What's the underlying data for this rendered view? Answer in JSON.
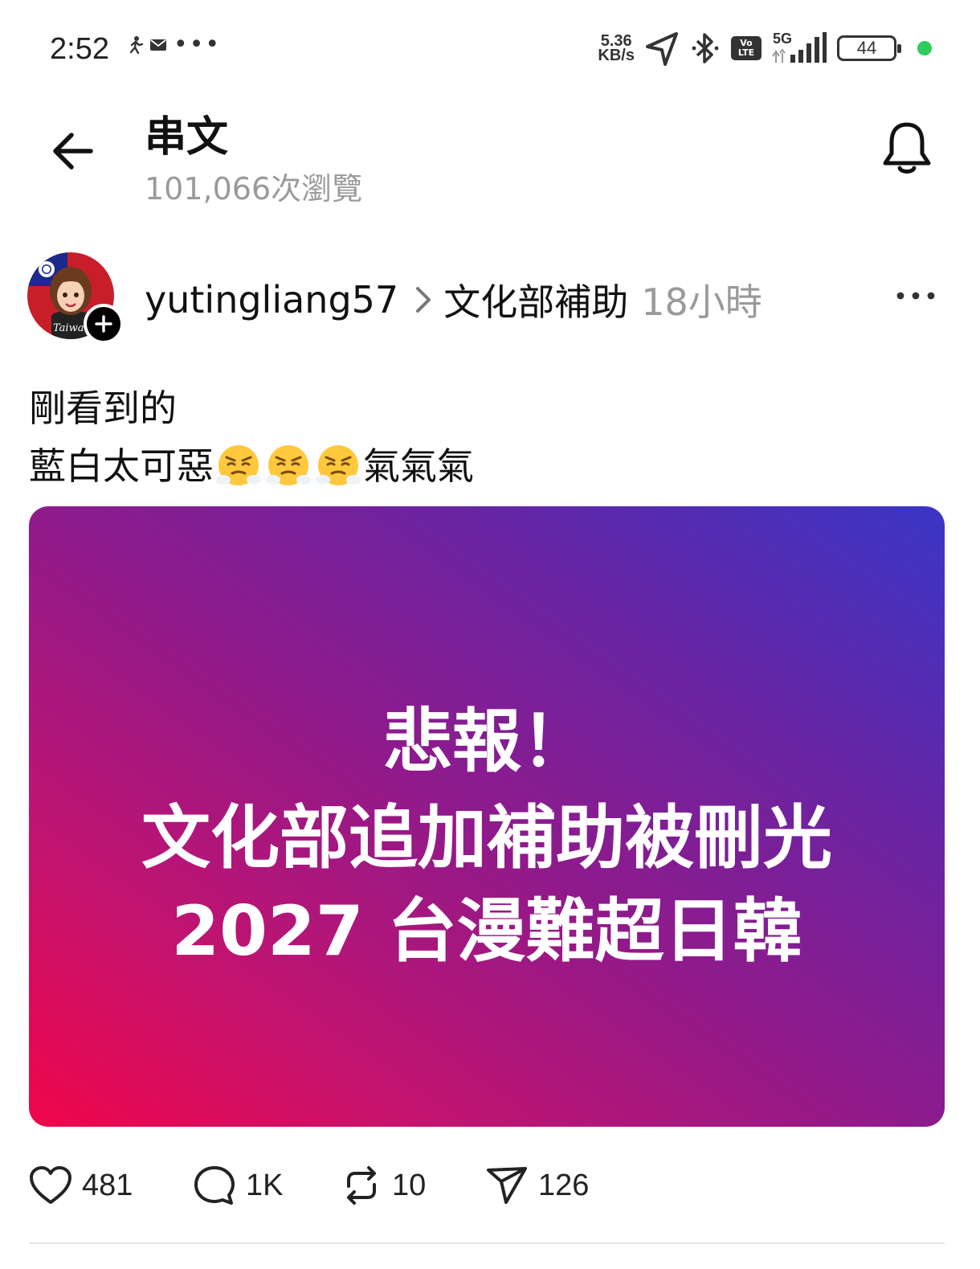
{
  "status_bar": {
    "time": "2:52",
    "more": "•••",
    "speed_value": "5.36",
    "speed_unit": "KB/s",
    "volte_top": "Vo",
    "volte_bottom": "LTE",
    "network": "5G",
    "battery": "44"
  },
  "header": {
    "title": "串文",
    "views": "101,066次瀏覽"
  },
  "post": {
    "author": "yutingliang57",
    "topic": "文化部補助",
    "time": "18小時",
    "line1": "剛看到的",
    "line2_before": "藍白太可惡",
    "line2_after": "氣氣氣",
    "emoji": "steam-from-nose-face",
    "avatar_badge_text": "Taiwan",
    "image": {
      "line1": "悲報！",
      "line2": "文化部追加補助被刪光",
      "line3": "2027 台漫難超日韓"
    }
  },
  "actions": {
    "likes": "481",
    "comments": "1K",
    "reposts": "10",
    "shares": "126"
  }
}
